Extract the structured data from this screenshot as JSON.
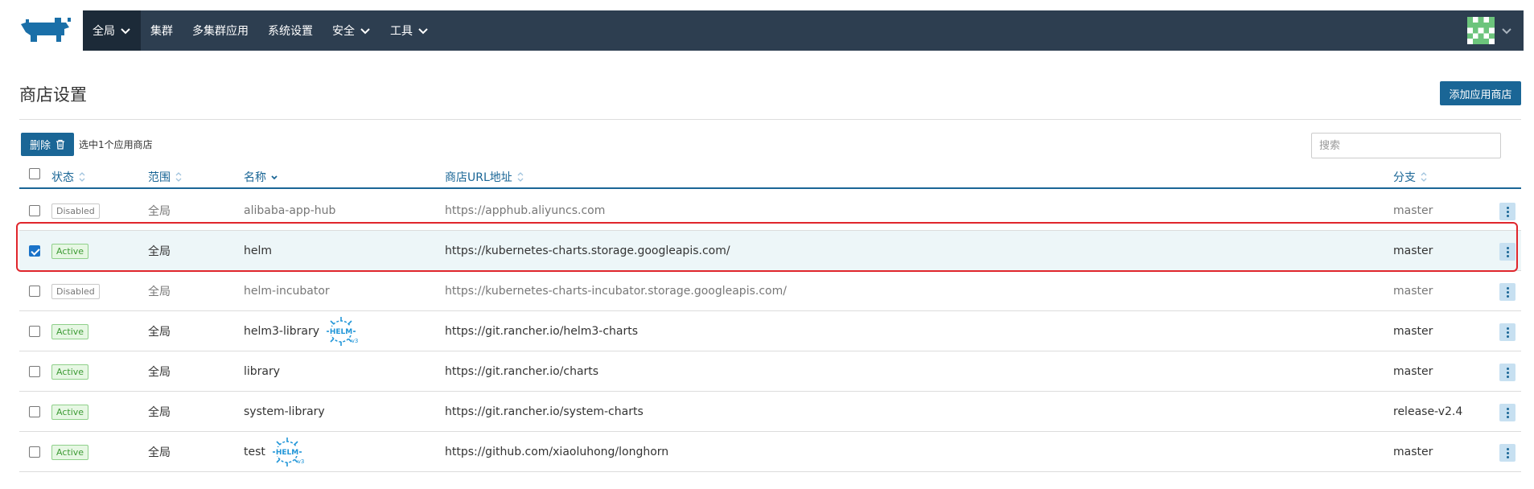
{
  "nav": {
    "items": [
      {
        "label": "全局",
        "has_dropdown": true,
        "active": true
      },
      {
        "label": "集群",
        "has_dropdown": false,
        "active": false
      },
      {
        "label": "多集群应用",
        "has_dropdown": false,
        "active": false
      },
      {
        "label": "系统设置",
        "has_dropdown": false,
        "active": false
      },
      {
        "label": "安全",
        "has_dropdown": true,
        "active": false
      },
      {
        "label": "工具",
        "has_dropdown": true,
        "active": false
      }
    ]
  },
  "page": {
    "title": "商店设置",
    "add_button": "添加应用商店"
  },
  "bulk": {
    "delete_label": "删除",
    "selected_text": "选中1个应用商店",
    "search_placeholder": "搜索"
  },
  "table": {
    "headers": {
      "state": "状态",
      "scope": "范围",
      "name": "名称",
      "url": "商店URL地址",
      "branch": "分支"
    },
    "rows": [
      {
        "checked": false,
        "state": "Disabled",
        "scope": "全局",
        "name": "alibaba-app-hub",
        "helm3": false,
        "url": "https://apphub.aliyuncs.com",
        "branch": "master"
      },
      {
        "checked": true,
        "state": "Active",
        "scope": "全局",
        "name": "helm",
        "helm3": false,
        "url": "https://kubernetes-charts.storage.googleapis.com/",
        "branch": "master"
      },
      {
        "checked": false,
        "state": "Disabled",
        "scope": "全局",
        "name": "helm-incubator",
        "helm3": false,
        "url": "https://kubernetes-charts-incubator.storage.googleapis.com/",
        "branch": "master"
      },
      {
        "checked": false,
        "state": "Active",
        "scope": "全局",
        "name": "helm3-library",
        "helm3": true,
        "url": "https://git.rancher.io/helm3-charts",
        "branch": "master"
      },
      {
        "checked": false,
        "state": "Active",
        "scope": "全局",
        "name": "library",
        "helm3": false,
        "url": "https://git.rancher.io/charts",
        "branch": "master"
      },
      {
        "checked": false,
        "state": "Active",
        "scope": "全局",
        "name": "system-library",
        "helm3": false,
        "url": "https://git.rancher.io/system-charts",
        "branch": "release-v2.4"
      },
      {
        "checked": false,
        "state": "Active",
        "scope": "全局",
        "name": "test",
        "helm3": true,
        "url": "https://github.com/xiaoluhong/longhorn",
        "branch": "master"
      }
    ]
  },
  "colors": {
    "navbar": "#2d3e50",
    "primary": "#1a6696",
    "active_green": "#3d9b35",
    "highlight_red": "#e0262c"
  }
}
